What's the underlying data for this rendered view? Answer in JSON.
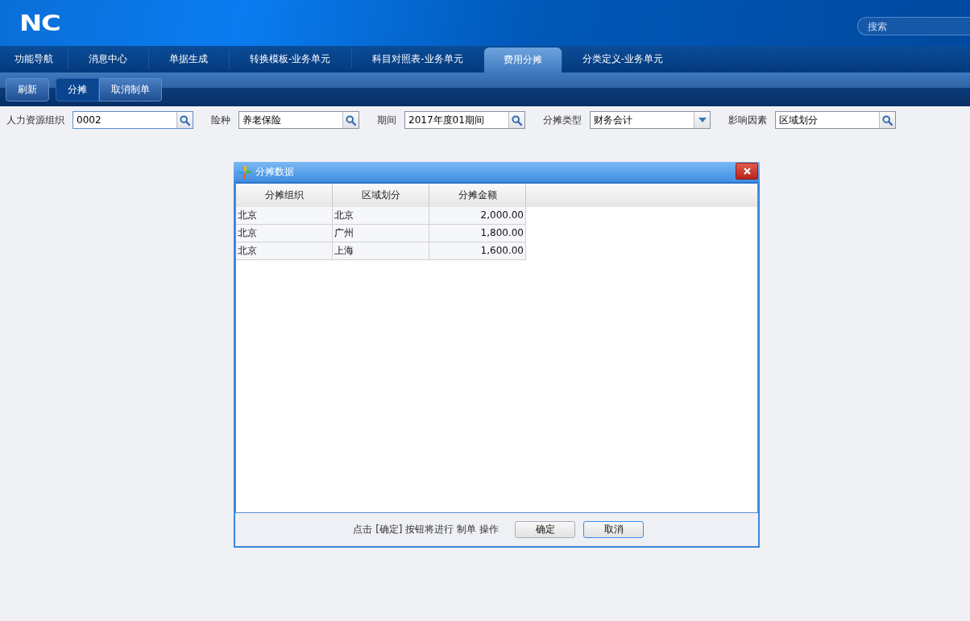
{
  "header": {
    "logo": "NC",
    "search": {
      "placeholder": "搜索"
    }
  },
  "tabs": [
    {
      "label": "功能导航",
      "selected": false
    },
    {
      "label": "消息中心",
      "selected": false
    },
    {
      "label": "单据生成",
      "selected": false
    },
    {
      "label": "转换模板-业务单元",
      "selected": false
    },
    {
      "label": "科目对照表-业务单元",
      "selected": false
    },
    {
      "label": "费用分摊",
      "selected": true
    },
    {
      "label": "分类定义-业务单元",
      "selected": false
    }
  ],
  "toolbar": {
    "groups": [
      [
        {
          "label": "刷新",
          "selected": false
        }
      ],
      [
        {
          "label": "分摊",
          "selected": true
        },
        {
          "label": "取消制单",
          "selected": false
        }
      ]
    ]
  },
  "filters": [
    {
      "label": "人力资源组织",
      "value": "0002",
      "kind": "lookup"
    },
    {
      "label": "险种",
      "value": "养老保险",
      "kind": "lookup"
    },
    {
      "label": "期间",
      "value": "2017年度01期间",
      "kind": "lookup"
    },
    {
      "label": "分摊类型",
      "value": "财务会计",
      "kind": "dropdown"
    },
    {
      "label": "影响因素",
      "value": "区域划分",
      "kind": "lookup"
    }
  ],
  "dialog": {
    "title": "分摊数据",
    "table": {
      "columns": [
        "分摊组织",
        "区域划分",
        "分摊金额"
      ],
      "rows": [
        [
          "北京",
          "北京",
          "2,000.00"
        ],
        [
          "北京",
          "广州",
          "1,800.00"
        ],
        [
          "北京",
          "上海",
          "1,600.00"
        ]
      ]
    },
    "message": "点击 [确定] 按钮将进行 制单 操作",
    "buttons": [
      {
        "label": "确定",
        "focused": false
      },
      {
        "label": "取消",
        "focused": true
      }
    ]
  }
}
